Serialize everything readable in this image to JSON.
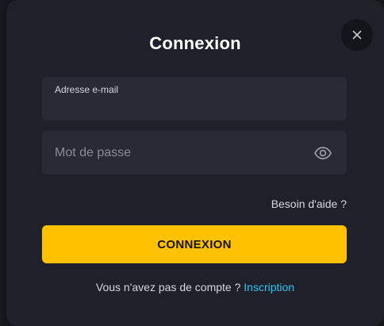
{
  "modal": {
    "title": "Connexion",
    "close_icon": "close-icon"
  },
  "email_field": {
    "label": "Adresse e-mail",
    "value": ""
  },
  "password_field": {
    "placeholder": "Mot de passe",
    "value": "",
    "toggle_icon": "eye-icon"
  },
  "help_link": "Besoin d'aide ?",
  "submit_button": "CONNEXION",
  "signup": {
    "prompt": "Vous n'avez pas de compte ?",
    "link": "Inscription"
  },
  "colors": {
    "accent": "#ffc100",
    "link": "#2fc5f0",
    "modal_bg": "#1f2029",
    "field_bg": "#292a36"
  }
}
